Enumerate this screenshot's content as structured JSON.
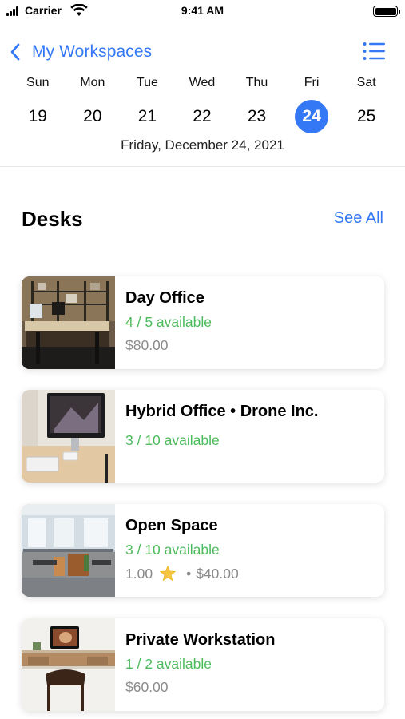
{
  "status_bar": {
    "carrier": "Carrier",
    "time": "9:41 AM"
  },
  "nav": {
    "back_label": "My Workspaces",
    "back_icon": "chevron-left-icon",
    "menu_icon": "list-icon"
  },
  "week": {
    "days": [
      "Sun",
      "Mon",
      "Tue",
      "Wed",
      "Thu",
      "Fri",
      "Sat"
    ],
    "dates": [
      "19",
      "20",
      "21",
      "22",
      "23",
      "24",
      "25"
    ],
    "selected_index": 5,
    "full_date": "Friday, December 24, 2021"
  },
  "section": {
    "title": "Desks",
    "see_all": "See All"
  },
  "cards": [
    {
      "title": "Day Office",
      "availability": "4 / 5 available",
      "price": "$80.00"
    },
    {
      "title": "Hybrid Office • Drone Inc.",
      "availability": "3 / 10 available"
    },
    {
      "title": "Open Space",
      "availability": "3 / 10 available",
      "rating": "1.00",
      "separator": "•",
      "price": "$40.00"
    },
    {
      "title": "Private Workstation",
      "availability": "1 / 2 available",
      "price": "$60.00"
    }
  ],
  "colors": {
    "accent": "#3478f6",
    "available": "#4cbb5c",
    "secondary_text": "#8a8a8a"
  }
}
